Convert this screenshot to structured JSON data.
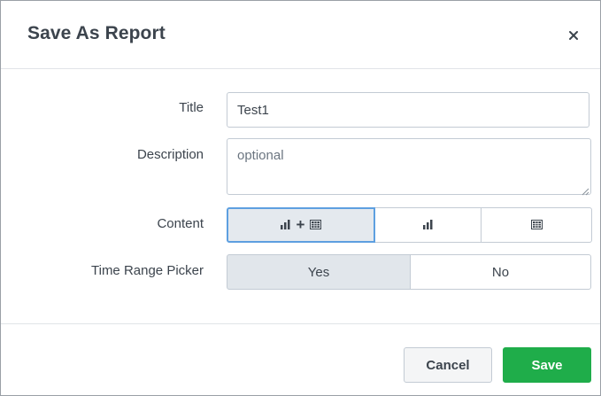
{
  "dialog": {
    "title": "Save As Report",
    "close_icon": "close-icon"
  },
  "form": {
    "title_label": "Title",
    "title_value": "Test1",
    "description_label": "Description",
    "description_placeholder": "optional",
    "content_label": "Content",
    "content_options": [
      {
        "name": "chart-plus-table",
        "plus": "+",
        "selected": true
      },
      {
        "name": "chart-only",
        "selected": false
      },
      {
        "name": "table-only",
        "selected": false
      }
    ],
    "time_range_label": "Time Range Picker",
    "time_range_options": [
      {
        "label": "Yes",
        "selected": true
      },
      {
        "label": "No",
        "selected": false
      }
    ]
  },
  "footer": {
    "cancel_label": "Cancel",
    "save_label": "Save"
  },
  "colors": {
    "save_green": "#1fad4a",
    "selected_outline": "#5d9fe0",
    "selected_fill": "#e1e6eb"
  }
}
